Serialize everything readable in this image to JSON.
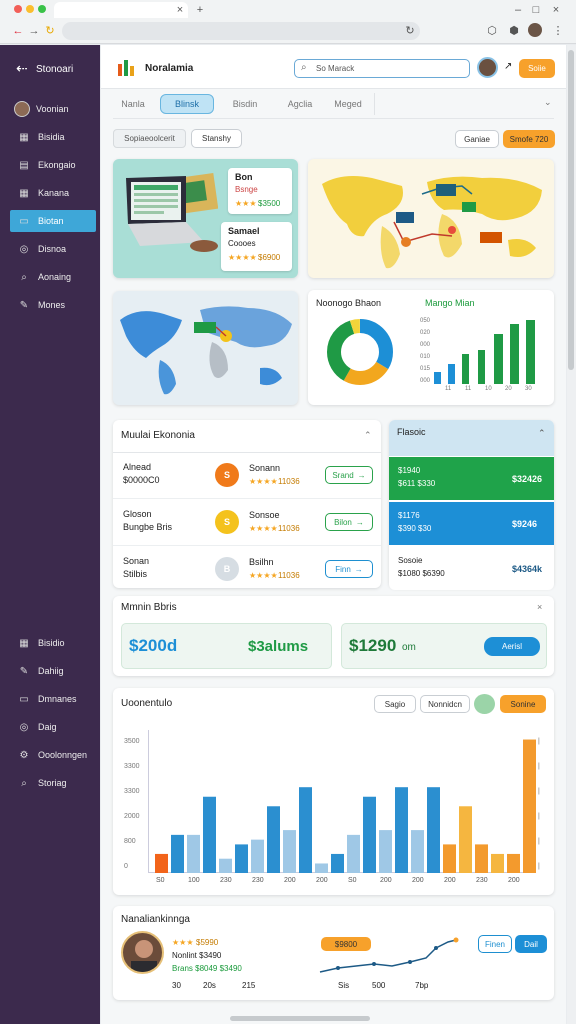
{
  "app": {
    "name": "Stonoari",
    "logo_text": "Noralamia"
  },
  "sidebar": {
    "items": [
      {
        "label": "Voonian",
        "icon": "avatar"
      },
      {
        "label": "Bisidia",
        "icon": "grid-icon"
      },
      {
        "label": "Ekongaio",
        "icon": "calendar-icon"
      },
      {
        "label": "Kanana",
        "icon": "table-icon"
      },
      {
        "label": "Biotan",
        "icon": "window-icon",
        "active": true
      },
      {
        "label": "Disnoa",
        "icon": "target-icon"
      },
      {
        "label": "Aonaing",
        "icon": "search-icon"
      },
      {
        "label": "Mones",
        "icon": "pen-icon"
      }
    ],
    "bottom_items": [
      {
        "label": "Bisidio",
        "icon": "table-icon"
      },
      {
        "label": "Dahiig",
        "icon": "pen-icon"
      },
      {
        "label": "Dmnanes",
        "icon": "window-icon"
      },
      {
        "label": "Daig",
        "icon": "target-icon"
      },
      {
        "label": "Ooolonngen",
        "icon": "gear-icon"
      },
      {
        "label": "Storiag",
        "icon": "search-icon"
      }
    ]
  },
  "header": {
    "search_placeholder": "So Marack",
    "action_label": "Soiie",
    "tabs": [
      "Nanla",
      "Blinsk",
      "Bisdin",
      "Agclia",
      "Meged"
    ],
    "active_tab": 1
  },
  "filters": {
    "left": "Sopiaeoolcerit",
    "left2": "Stanshy",
    "right1": "Ganiae",
    "right2": "Smofe 720"
  },
  "promo": {
    "c1_title": "Bon",
    "c1_sub": "Bsnge",
    "c1_price": "$3500",
    "c2_title": "Samael",
    "c2_sub": "Coooes",
    "c2_price": "$6900"
  },
  "donut_card": {
    "title": "Noonogo Bhaon",
    "chart_title": "Mango Mian",
    "y_ticks": [
      "050",
      "020",
      "000",
      "010",
      "015",
      "000"
    ],
    "x_ticks": [
      "11",
      "11",
      "10",
      "20",
      "30"
    ]
  },
  "products": {
    "title": "Muulai Ekononia",
    "rows": [
      {
        "name": "Alnead",
        "sub": "$0000C0",
        "title": "Sonann",
        "meta": "11036",
        "btn": "Srand",
        "color": "#f07a1a",
        "icon": "S",
        "btn_style": "green"
      },
      {
        "name": "Gloson",
        "sub": "Bungbe Bris",
        "title": "Sonsoe",
        "meta": "11036",
        "btn": "Bilon",
        "color": "#f4c21d",
        "icon": "S",
        "btn_style": "green"
      },
      {
        "name": "Sonan",
        "sub": "Stilbis",
        "title": "Bsilhn",
        "meta": "11036",
        "btn": "Finn",
        "color": "#d6dde3",
        "icon": "B",
        "btn_style": "blue"
      }
    ]
  },
  "finance": {
    "title": "Flasoic",
    "rows": [
      {
        "top": "$1940",
        "left": "$611 $330",
        "right": "$32426",
        "style": "green"
      },
      {
        "top": "$1176",
        "left": "$390 $30",
        "right": "$9246",
        "style": "blue"
      },
      {
        "top": "Sosoie",
        "left": "$1080 $6390",
        "right": "$4364k",
        "style": "white"
      }
    ]
  },
  "summary": {
    "title": "Mmnin Bbris",
    "v1": "$200d",
    "v2": "$3alums",
    "v3": "$1290",
    "v3_unit": "om",
    "btn": "Aerisl"
  },
  "barchart": {
    "title": "Uoonentulo",
    "btn1": "Sagio",
    "btn2": "Nonnidcn",
    "btn3": "Sonine",
    "y_ticks": [
      "3500",
      "3300",
      "3300",
      "2000",
      "800",
      "0"
    ],
    "x_ticks": [
      "S0",
      "100",
      "230",
      "230",
      "200",
      "200",
      "S0",
      "200",
      "200",
      "200",
      "230",
      "200"
    ]
  },
  "chart_data": {
    "type": "bar",
    "title": "Uoonentulo",
    "series": [
      {
        "values": [
          1,
          2,
          6,
          3,
          5,
          2,
          3,
          5,
          6,
          3,
          3,
          2
        ],
        "color": "#f39a2d"
      },
      {
        "values": [
          4,
          8,
          3,
          7,
          9,
          2,
          8,
          9,
          9,
          7,
          2,
          14
        ],
        "color": "#2b8fd0"
      }
    ],
    "y_ticks_left": [
      "3500",
      "3300",
      "3300",
      "2000",
      "800",
      "0"
    ]
  },
  "bottom": {
    "title": "Nanaliankinnga",
    "l1": "$5990",
    "l2": "Nonlint $3490",
    "l3": "Brans $8049 $3490",
    "x1": "30",
    "x2": "20s",
    "x3": "215",
    "pill": "$9800",
    "x4": "Sis",
    "x5": "500",
    "x6": "7bp",
    "b1": "Finen",
    "b2": "Dail"
  },
  "colors": {
    "sidebar": "#3c2a4d",
    "accent_blue": "#3ea7d8",
    "green": "#2aa24b",
    "orange": "#f7a12b"
  }
}
